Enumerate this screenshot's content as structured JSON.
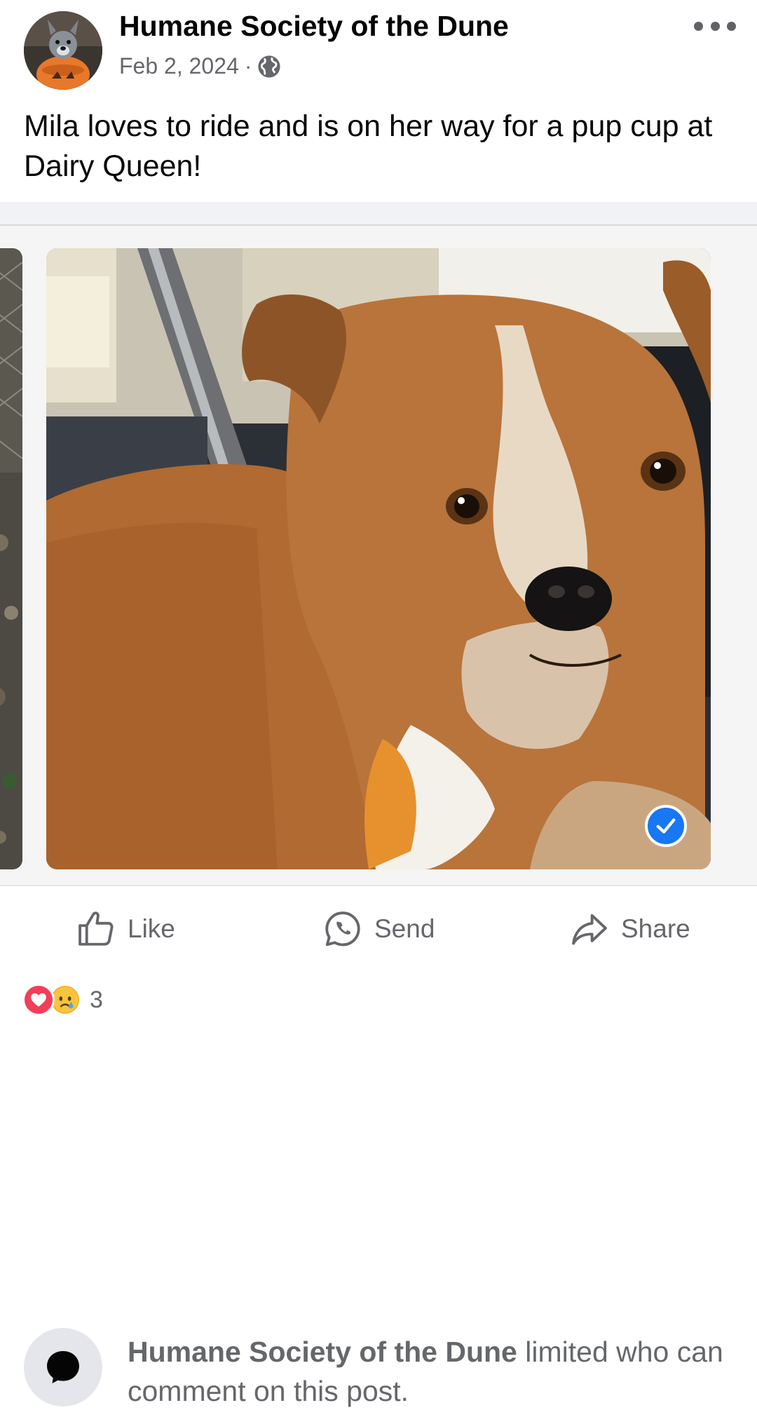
{
  "post": {
    "page_name": "Humane Society of the Dune",
    "date": "Feb 2, 2024",
    "separator": "·",
    "audience_icon": "globe-icon",
    "more_icon": "more-horizontal-icon",
    "caption": "Mila loves to ride and is on her way for a pup cup at Dairy Queen!"
  },
  "photo": {
    "selected_icon": "checkmark-circle-icon",
    "accent_color": "#1877f2"
  },
  "actions": {
    "like_label": "Like",
    "send_label": "Send",
    "share_label": "Share"
  },
  "reactions": {
    "types": [
      "love",
      "sad"
    ],
    "count": "3",
    "love_color": "#f33e58",
    "sad_color": "#f7b125"
  },
  "comment_notice": {
    "page_name": "Humane Society of the Dune",
    "text": " limited who can comment on this post."
  }
}
